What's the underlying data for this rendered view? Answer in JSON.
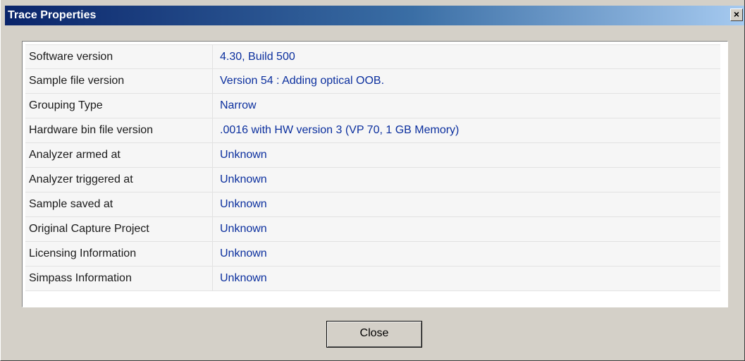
{
  "window": {
    "title": "Trace Properties",
    "close_glyph": "×"
  },
  "properties": [
    {
      "name": "Software version",
      "value": "4.30, Build 500"
    },
    {
      "name": "Sample file version",
      "value": "Version 54 : Adding optical OOB."
    },
    {
      "name": "Grouping Type",
      "value": "Narrow"
    },
    {
      "name": "Hardware bin file version",
      "value": ".0016 with HW version 3 (VP 70, 1 GB Memory)"
    },
    {
      "name": "Analyzer armed at",
      "value": "Unknown"
    },
    {
      "name": "Analyzer triggered at",
      "value": "Unknown"
    },
    {
      "name": "Sample saved at",
      "value": "Unknown"
    },
    {
      "name": "Original Capture Project",
      "value": "Unknown"
    },
    {
      "name": "Licensing Information",
      "value": "Unknown"
    },
    {
      "name": "Simpass Information",
      "value": "Unknown"
    }
  ],
  "buttons": {
    "close_label": "Close"
  },
  "colors": {
    "title_gradient_start": "#0a246a",
    "title_gradient_end": "#a6caf0",
    "value_text": "#0b2f9e",
    "dialog_face": "#d4d0c8"
  }
}
